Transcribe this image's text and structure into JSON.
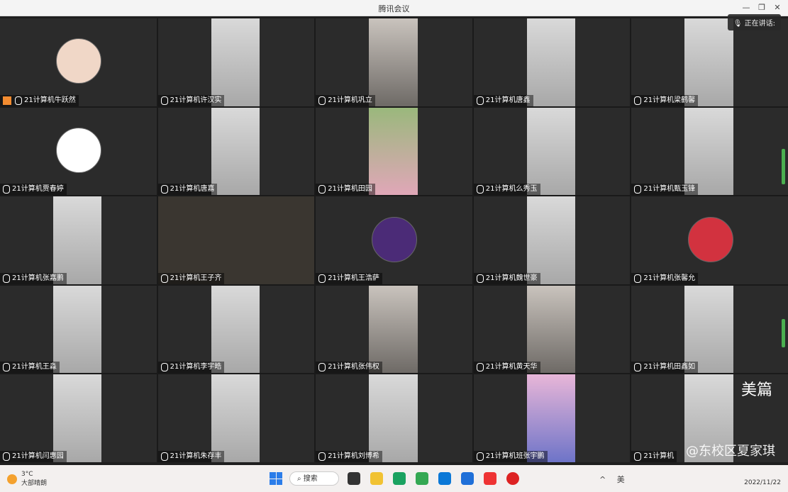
{
  "window": {
    "title": "腾讯会议"
  },
  "speaking": {
    "label": "正在讲话:"
  },
  "participants": [
    {
      "name": "21计算机牛跃然",
      "kind": "avatar",
      "style": ""
    },
    {
      "name": "21计算机许汉实",
      "kind": "video",
      "style": ""
    },
    {
      "name": "21计算机巩立",
      "kind": "video",
      "style": "dark"
    },
    {
      "name": "21计算机唐鑫",
      "kind": "video",
      "style": ""
    },
    {
      "name": "21计算机梁鹤馨",
      "kind": "video",
      "style": ""
    },
    {
      "name": "21计算机贾春婷",
      "kind": "avatar",
      "style": "bw"
    },
    {
      "name": "21计算机唐嘉",
      "kind": "video",
      "style": ""
    },
    {
      "name": "21计算机田园",
      "kind": "video",
      "style": "pink"
    },
    {
      "name": "21计算机么秀玉",
      "kind": "video",
      "style": ""
    },
    {
      "name": "21计算机甄玉锋",
      "kind": "video",
      "style": ""
    },
    {
      "name": "21计算机张嘉鹏",
      "kind": "video",
      "style": ""
    },
    {
      "name": "21计算机王子齐",
      "kind": "none",
      "style": ""
    },
    {
      "name": "21计算机王浩萨",
      "kind": "avatar",
      "style": "purple"
    },
    {
      "name": "21计算机魏世豪",
      "kind": "video",
      "style": ""
    },
    {
      "name": "21计算机张馨允",
      "kind": "avatar",
      "style": "red"
    },
    {
      "name": "21计算机王淼",
      "kind": "video",
      "style": ""
    },
    {
      "name": "21计算机李宇皓",
      "kind": "video",
      "style": ""
    },
    {
      "name": "21计算机张伟权",
      "kind": "video",
      "style": "dark"
    },
    {
      "name": "21计算机黄天华",
      "kind": "video",
      "style": "dark"
    },
    {
      "name": "21计算机田鑫如",
      "kind": "video",
      "style": ""
    },
    {
      "name": "21计算机闫惠园",
      "kind": "video",
      "style": ""
    },
    {
      "name": "21计算机朱存丰",
      "kind": "video",
      "style": ""
    },
    {
      "name": "21计算机刘博希",
      "kind": "video",
      "style": ""
    },
    {
      "name": "21计算机班张宇鹏",
      "kind": "video",
      "style": "anime"
    },
    {
      "name": "21计算机",
      "kind": "video",
      "style": ""
    }
  ],
  "watermark": {
    "logo": "美篇",
    "text": "@东校区夏家琪"
  },
  "taskbar": {
    "weather_temp": "3°C",
    "weather_desc": "大部晴朗",
    "search": "搜索",
    "tray_text": "^ 美",
    "date": "2022/11/22"
  }
}
